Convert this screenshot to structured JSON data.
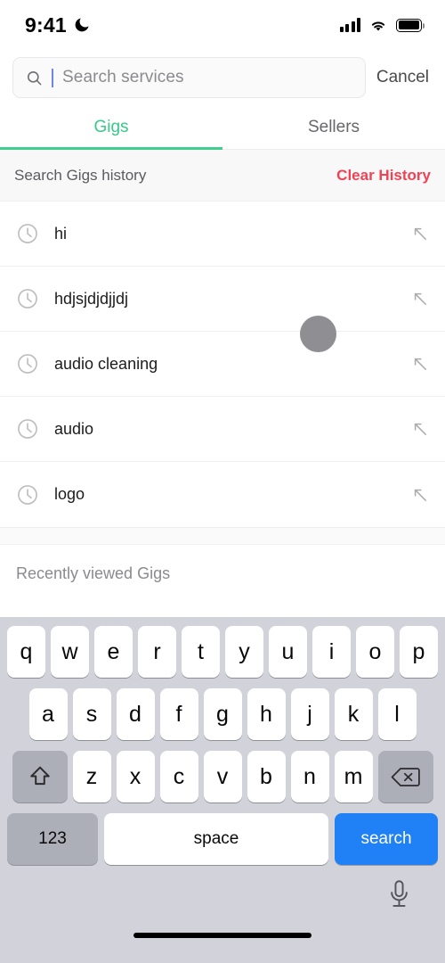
{
  "status_bar": {
    "time": "9:41",
    "dnd_icon": "moon-icon",
    "signal_icon": "cellular-signal-icon",
    "wifi_icon": "wifi-icon",
    "battery_icon": "battery-icon"
  },
  "search": {
    "icon": "search-icon",
    "value": "",
    "placeholder": "Search services",
    "cancel_label": "Cancel"
  },
  "tabs": [
    {
      "label": "Gigs",
      "active": true
    },
    {
      "label": "Sellers",
      "active": false
    }
  ],
  "history": {
    "title": "Search Gigs history",
    "clear_label": "Clear History",
    "row_icon": "clock-icon",
    "fill_icon": "arrow-up-left-icon",
    "items": [
      {
        "label": "hi"
      },
      {
        "label": "hdjsjdjdjjdj"
      },
      {
        "label": "audio cleaning"
      },
      {
        "label": "audio"
      },
      {
        "label": "logo"
      }
    ]
  },
  "recent": {
    "title": "Recently viewed Gigs"
  },
  "keyboard": {
    "row1": [
      "q",
      "w",
      "e",
      "r",
      "t",
      "y",
      "u",
      "i",
      "o",
      "p"
    ],
    "row2": [
      "a",
      "s",
      "d",
      "f",
      "g",
      "h",
      "j",
      "k",
      "l"
    ],
    "row3": [
      "z",
      "x",
      "c",
      "v",
      "b",
      "n",
      "m"
    ],
    "shift_icon": "shift-icon",
    "backspace_icon": "backspace-icon",
    "numbers_label": "123",
    "space_label": "space",
    "return_label": "search",
    "mic_icon": "microphone-icon"
  },
  "colors": {
    "accent_green": "#3ecf8e",
    "clear_red": "#f04155",
    "key_blue": "#1f81f5",
    "keyboard_bg": "#d2d3da",
    "touch_dot": "#8e8e93"
  },
  "touch_indicator": {
    "name": "touch-point-indicator"
  }
}
